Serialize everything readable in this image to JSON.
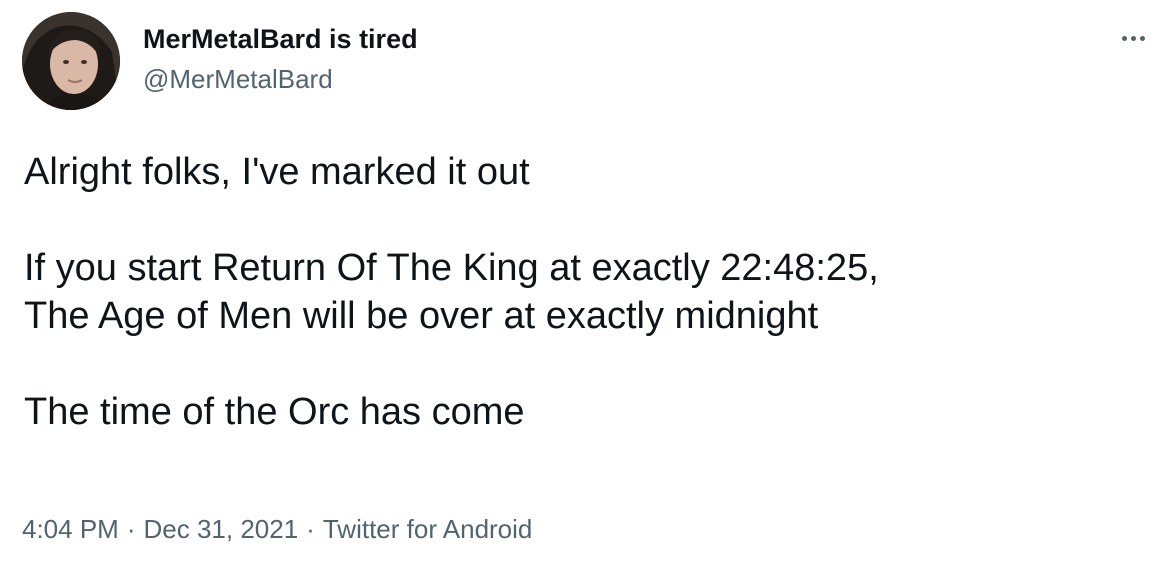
{
  "author": {
    "display_name": "MerMetalBard is tired",
    "handle": "@MerMetalBard",
    "avatar_icon": "user-avatar"
  },
  "menu": {
    "more_icon": "more-options-icon"
  },
  "tweet": {
    "paragraphs": [
      [
        "Alright folks, I've marked it out"
      ],
      [
        "If you start Return Of The King at exactly 22:48:25,",
        "The Age of Men will be over at exactly midnight"
      ],
      [
        "The time of the Orc has come"
      ]
    ]
  },
  "meta": {
    "time": "4:04 PM",
    "separator": "·",
    "date": "Dec 31, 2021",
    "source": "Twitter for Android"
  },
  "colors": {
    "text_primary": "#0f1419",
    "text_secondary": "#536471",
    "background": "#ffffff"
  }
}
